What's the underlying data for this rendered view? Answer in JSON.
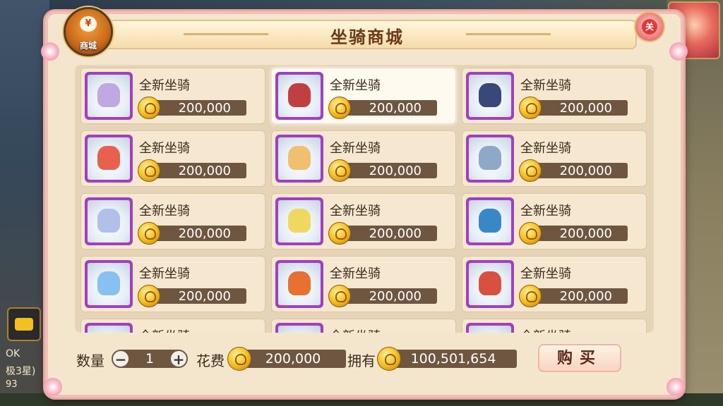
{
  "shop": {
    "title": "坐骑商城",
    "icon_label": "商城",
    "icon_symbol": "¥",
    "close_symbol": "关"
  },
  "items": [
    {
      "name": "全新坐骑",
      "price": "200,000",
      "color": "#c0a8e0"
    },
    {
      "name": "全新坐骑",
      "price": "200,000",
      "color": "#c04040"
    },
    {
      "name": "全新坐骑",
      "price": "200,000",
      "color": "#384878"
    },
    {
      "name": "全新坐骑",
      "price": "200,000",
      "color": "#e86050"
    },
    {
      "name": "全新坐骑",
      "price": "200,000",
      "color": "#f0c070"
    },
    {
      "name": "全新坐骑",
      "price": "200,000",
      "color": "#90a8c8"
    },
    {
      "name": "全新坐骑",
      "price": "200,000",
      "color": "#b0c0e8"
    },
    {
      "name": "全新坐骑",
      "price": "200,000",
      "color": "#f0d860"
    },
    {
      "name": "全新坐骑",
      "price": "200,000",
      "color": "#3888c8"
    },
    {
      "name": "全新坐骑",
      "price": "200,000",
      "color": "#88c0f0"
    },
    {
      "name": "全新坐骑",
      "price": "200,000",
      "color": "#e87030"
    },
    {
      "name": "全新坐骑",
      "price": "200,000",
      "color": "#d85040"
    },
    {
      "name": "全新坐骑",
      "price": "",
      "color": "#b090d0"
    },
    {
      "name": "全新坐骑",
      "price": "",
      "color": "#d0a060"
    },
    {
      "name": "全新坐骑",
      "price": "",
      "color": "#a0b0d0"
    }
  ],
  "purchase": {
    "quantity_label": "数量",
    "quantity": "1",
    "cost_label": "花费",
    "cost": "200,000",
    "owned_label": "拥有",
    "owned": "100,501,654",
    "buy_label": "购买"
  },
  "side": {
    "line1": "OK",
    "line2": "极3星)",
    "line3": "93"
  },
  "colors": {
    "thumb_border": "#a040c0",
    "price_bar": "#6e5640",
    "panel_bg": "#f4e6cc"
  }
}
